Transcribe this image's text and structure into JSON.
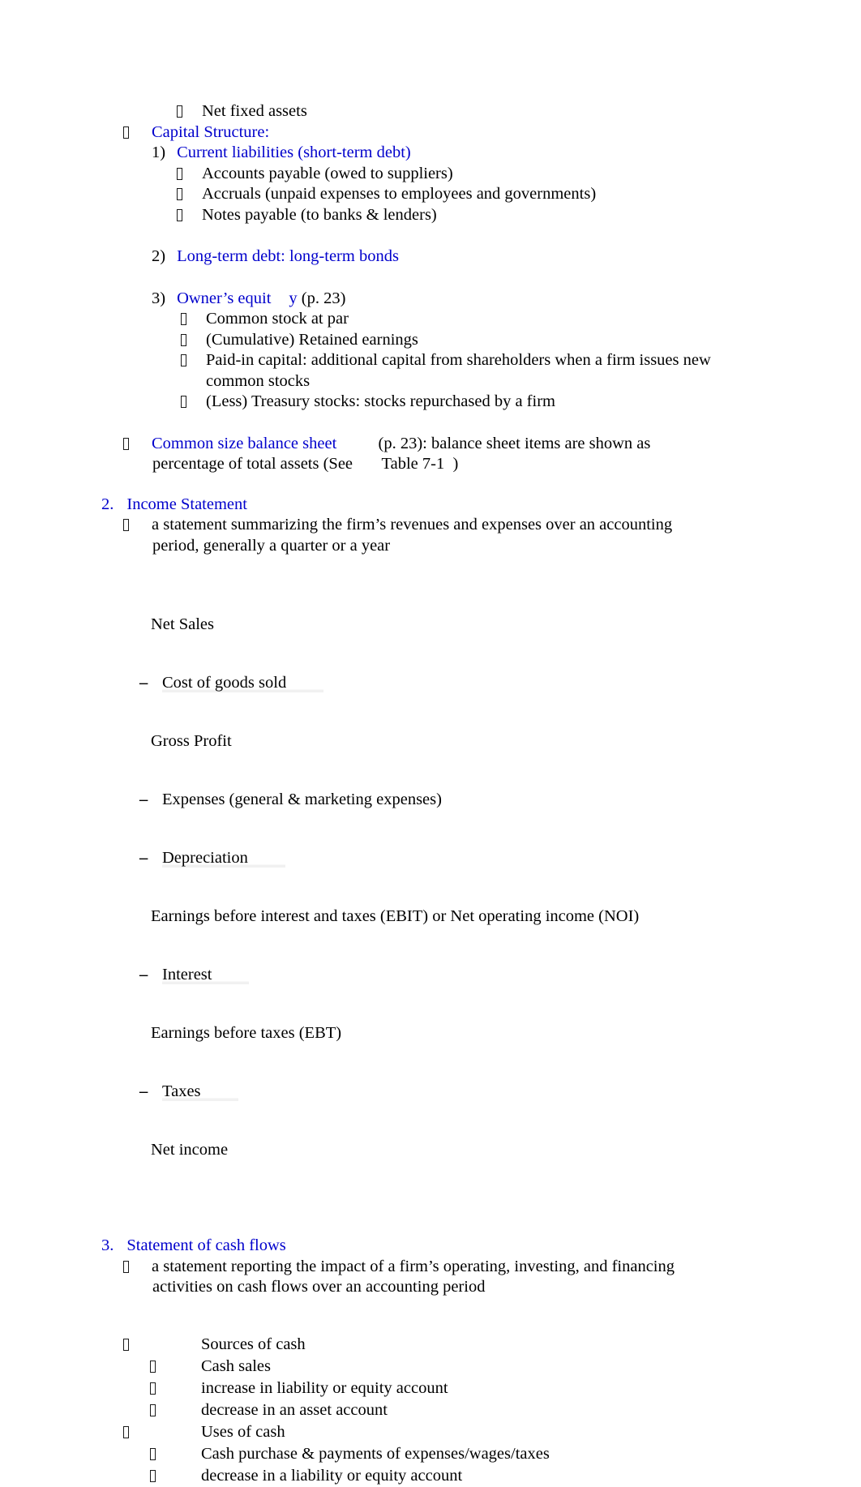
{
  "document": {
    "type": "lecture-outline",
    "topic": "Financial Statements",
    "heading_color": "#0000CC",
    "body_color": "#000000",
    "background_color": "#FFFFFF",
    "bullet_glyph": "missing-glyph-box"
  },
  "balance_sheet_tail": {
    "net_fixed_assets": "Net fixed assets",
    "capital_structure": "Capital Structure:",
    "items": [
      {
        "number": "1)",
        "label": "Current liabilities (short-term debt)",
        "subitems": [
          "Accounts payable (owed to suppliers)",
          "Accruals (unpaid expenses to employees and governments)",
          "Notes payable (to banks & lenders)"
        ]
      },
      {
        "number": "2)",
        "label": "Long-term debt: long-term bonds",
        "subitems": []
      },
      {
        "number": "3)",
        "label_blue_a": "Owner’s equit",
        "label_blue_b": "y",
        "label_black": " (p. 23)",
        "subitems": [
          "Common stock at par",
          "(Cumulative) Retained earnings",
          "Paid-in capital: additional capital from shareholders when a firm issues new common stocks",
          "(Less) Treasury stocks: stocks repurchased by a firm"
        ]
      }
    ],
    "common_size": {
      "term": "Common size balance sheet",
      "definition_line1": "          (p. 23): balance sheet items are shown as",
      "definition_line2": "percentage of total assets (See       Table 7-1  )"
    }
  },
  "income_statement": {
    "number": "2.",
    "title": "Income Statement",
    "definition_line1": "a statement summarizing the firm’s revenues and expenses over an accounting",
    "definition_line2": "period, generally a quarter or a year",
    "calculation": [
      {
        "op": "",
        "label": "Net Sales",
        "underline": false
      },
      {
        "op": "–",
        "label": "Cost of goods sold",
        "underline": true
      },
      {
        "op": "",
        "label": "Gross Profit",
        "underline": false
      },
      {
        "op": "–",
        "label": "Expenses (general & marketing expenses)",
        "underline": false
      },
      {
        "op": "–",
        "label": "Depreciation",
        "underline": true
      },
      {
        "op": "",
        "label": "Earnings before interest and taxes (EBIT) or Net operating income (NOI)",
        "underline": false
      },
      {
        "op": "–",
        "label": "Interest",
        "underline": true
      },
      {
        "op": "",
        "label": "Earnings before taxes (EBT)",
        "underline": false
      },
      {
        "op": "–",
        "label": "Taxes",
        "underline": true
      },
      {
        "op": "",
        "label": "Net income",
        "underline": false
      }
    ]
  },
  "cash_flows": {
    "number": "3.",
    "title": "Statement of cash flows",
    "definition_line1": "a statement reporting the impact of a firm’s operating, investing, and financing",
    "definition_line2": "activities on cash flows over an accounting period",
    "sources": {
      "heading": "Sources of cash",
      "items": [
        "Cash sales",
        "increase in liability or equity account",
        "decrease in an asset account"
      ]
    },
    "uses": {
      "heading": "Uses of cash",
      "items": [
        "Cash purchase & payments of expenses/wages/taxes",
        "decrease in a liability or equity account"
      ]
    }
  }
}
